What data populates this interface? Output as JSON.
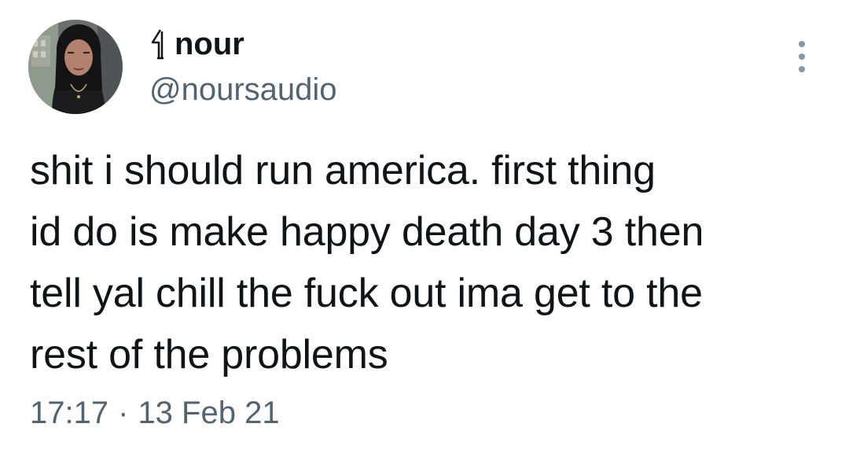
{
  "tweet": {
    "author": {
      "display_emoji": "nazar-hand-emoji",
      "display_name": "nour",
      "handle": "@noursaudio"
    },
    "more_icon": "more-vertical-icon",
    "text_lines": [
      "shit i should run america. first thing",
      "id do is make happy death day 3 then",
      "tell yal chill the fuck out ima get to the",
      "rest of the problems"
    ],
    "time": "17:17",
    "separator": "·",
    "date": "13 Feb 21"
  },
  "colors": {
    "primary_text": "#0f1419",
    "secondary_text": "#536471",
    "background": "#ffffff"
  }
}
